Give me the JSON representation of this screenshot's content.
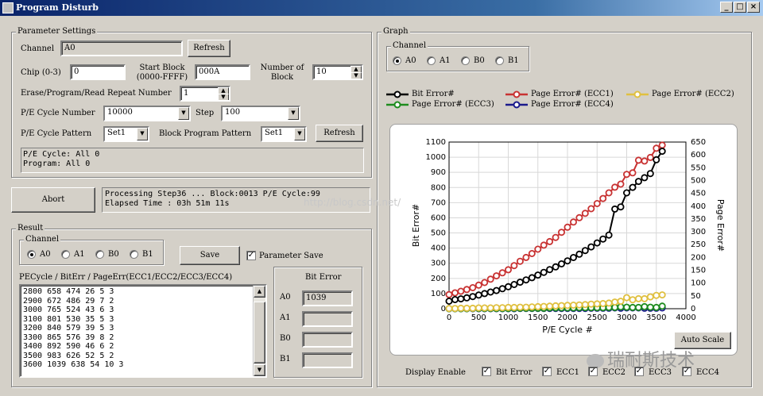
{
  "window": {
    "title": "Program Disturb",
    "icon": "app-icon"
  },
  "params": {
    "group_label": "Parameter Settings",
    "channel_label": "Channel",
    "channel_value": "A0",
    "refresh_label": "Refresh",
    "chip_label": "Chip (0-3)",
    "chip_value": "0",
    "start_block_label_1": "Start Block",
    "start_block_label_2": "(0000-FFFF)",
    "start_block_value": "000A",
    "num_block_label_1": "Number of",
    "num_block_label_2": "Block",
    "num_block_value": "10",
    "repeat_label": "Erase/Program/Read Repeat Number",
    "repeat_value": "1",
    "pe_cycle_label": "P/E Cycle Number",
    "pe_cycle_value": "10000",
    "step_label": "Step",
    "step_value": "100",
    "pattern_label": "P/E Cycle Pattern",
    "pattern_value": "Set1",
    "block_pattern_label": "Block Program Pattern",
    "block_pattern_value": "Set1",
    "refresh2_label": "Refresh",
    "status_line1": "P/E Cycle: All 0",
    "status_line2": "Program: All 0"
  },
  "progress": {
    "abort_label": "Abort",
    "line1": "Processing Step36 ... Block:0013 P/E Cycle:99",
    "line2": "Elapsed Time : 03h 51m 11s"
  },
  "result": {
    "group_label": "Result",
    "channel_group_label": "Channel",
    "channels": [
      {
        "label": "A0",
        "selected": true
      },
      {
        "label": "A1",
        "selected": false
      },
      {
        "label": "B0",
        "selected": false
      },
      {
        "label": "B1",
        "selected": false
      }
    ],
    "save_label": "Save",
    "param_save_label": "Parameter Save",
    "param_save_checked": true,
    "list_header": "PECycle / BitErr / PageErr(ECC1/ECC2/ECC3/ECC4)",
    "rows": [
      "2800 658 474 26 5 3",
      "2900 672 486 29 7 2",
      "3000 765 524 43 6 3",
      "3100 801 530 35 5 3",
      "3200 840 579 39 5 3",
      "3300 865 576 39 8 2",
      "3400 892 590 46 6 2",
      "3500 983 626 52 5 2",
      "3600 1039 638 54 10 3"
    ],
    "bit_error_label": "Bit Error",
    "bit_errors": [
      {
        "label": "A0",
        "value": "1039"
      },
      {
        "label": "A1",
        "value": ""
      },
      {
        "label": "B0",
        "value": ""
      },
      {
        "label": "B1",
        "value": ""
      }
    ]
  },
  "graph": {
    "group_label": "Graph",
    "channel_group_label": "Channel",
    "channels": [
      {
        "label": "A0",
        "selected": true
      },
      {
        "label": "A1",
        "selected": false
      },
      {
        "label": "B0",
        "selected": false
      },
      {
        "label": "B1",
        "selected": false
      }
    ],
    "legend": [
      {
        "label": "Bit Error#",
        "color": "#000000"
      },
      {
        "label": "Page Error# (ECC1)",
        "color": "#c83232"
      },
      {
        "label": "Page Error# (ECC2)",
        "color": "#e0c040"
      },
      {
        "label": "Page Error# (ECC3)",
        "color": "#1e8c1e"
      },
      {
        "label": "Page Error# (ECC4)",
        "color": "#1a1a8c"
      }
    ],
    "auto_scale_label": "Auto Scale",
    "display_enable_label": "Display Enable",
    "enable_items": [
      {
        "label": "Bit Error",
        "checked": true
      },
      {
        "label": "ECC1",
        "checked": true
      },
      {
        "label": "ECC2",
        "checked": true
      },
      {
        "label": "ECC3",
        "checked": true
      },
      {
        "label": "ECC4",
        "checked": true
      }
    ],
    "watermark_url": "http://blog.csdn.net/",
    "watermark_brand": "瑞耐斯技术"
  },
  "chart_data": {
    "type": "line",
    "xlabel": "P/E Cycle #",
    "ylabel": "Bit Error#",
    "y2label": "Page Error#",
    "xlim": [
      0,
      4000
    ],
    "ylim": [
      0,
      1100
    ],
    "y2lim": [
      0,
      650
    ],
    "x_ticks": [
      "0",
      "500",
      "1000",
      "1500",
      "2000",
      "2500",
      "3000",
      "3500",
      "4000"
    ],
    "y_ticks": [
      "0",
      "100",
      "200",
      "300",
      "400",
      "500",
      "600",
      "700",
      "800",
      "900",
      "1000",
      "1100"
    ],
    "y2_ticks": [
      "0",
      "50",
      "100",
      "150",
      "200",
      "250",
      "300",
      "350",
      "400",
      "450",
      "500",
      "550",
      "600",
      "650"
    ],
    "x": [
      0,
      100,
      200,
      300,
      400,
      500,
      600,
      700,
      800,
      900,
      1000,
      1100,
      1200,
      1300,
      1400,
      1500,
      1600,
      1700,
      1800,
      1900,
      2000,
      2100,
      2200,
      2300,
      2400,
      2500,
      2600,
      2700,
      2800,
      2900,
      3000,
      3100,
      3200,
      3300,
      3400,
      3500,
      3600
    ],
    "series": [
      {
        "name": "Bit Error#",
        "axis": "left",
        "color": "#000000",
        "values": [
          50,
          60,
          65,
          72,
          80,
          90,
          100,
          110,
          120,
          132,
          145,
          160,
          175,
          190,
          205,
          222,
          240,
          258,
          276,
          296,
          316,
          338,
          360,
          384,
          408,
          434,
          460,
          486,
          658,
          672,
          765,
          801,
          840,
          865,
          892,
          983,
          1039
        ]
      },
      {
        "name": "Page Error# (ECC1)",
        "axis": "right",
        "color": "#c83232",
        "values": [
          55,
          62,
          68,
          75,
          82,
          92,
          102,
          115,
          128,
          140,
          152,
          168,
          185,
          200,
          215,
          232,
          248,
          262,
          278,
          298,
          318,
          338,
          355,
          372,
          390,
          410,
          430,
          452,
          474,
          486,
          524,
          530,
          579,
          576,
          590,
          626,
          638
        ]
      },
      {
        "name": "Page Error# (ECC2)",
        "axis": "right",
        "color": "#e0c040",
        "values": [
          1,
          1,
          2,
          2,
          2,
          3,
          3,
          3,
          4,
          4,
          5,
          5,
          6,
          6,
          7,
          8,
          9,
          10,
          11,
          12,
          13,
          14,
          15,
          16,
          18,
          19,
          20,
          22,
          26,
          29,
          43,
          35,
          39,
          39,
          46,
          52,
          54
        ]
      },
      {
        "name": "Page Error# (ECC3)",
        "axis": "right",
        "color": "#1e8c1e",
        "values": [
          0,
          0,
          0,
          0,
          1,
          1,
          1,
          1,
          1,
          1,
          1,
          2,
          2,
          2,
          2,
          2,
          2,
          3,
          3,
          3,
          3,
          3,
          4,
          4,
          4,
          4,
          4,
          5,
          5,
          7,
          6,
          5,
          5,
          8,
          6,
          5,
          10
        ]
      },
      {
        "name": "Page Error# (ECC4)",
        "axis": "right",
        "color": "#1a1a8c",
        "values": [
          0,
          0,
          0,
          0,
          0,
          0,
          0,
          0,
          0,
          0,
          0,
          0,
          1,
          1,
          1,
          1,
          1,
          1,
          1,
          1,
          1,
          1,
          1,
          1,
          2,
          2,
          2,
          2,
          3,
          2,
          3,
          3,
          3,
          2,
          2,
          2,
          3
        ]
      }
    ]
  }
}
